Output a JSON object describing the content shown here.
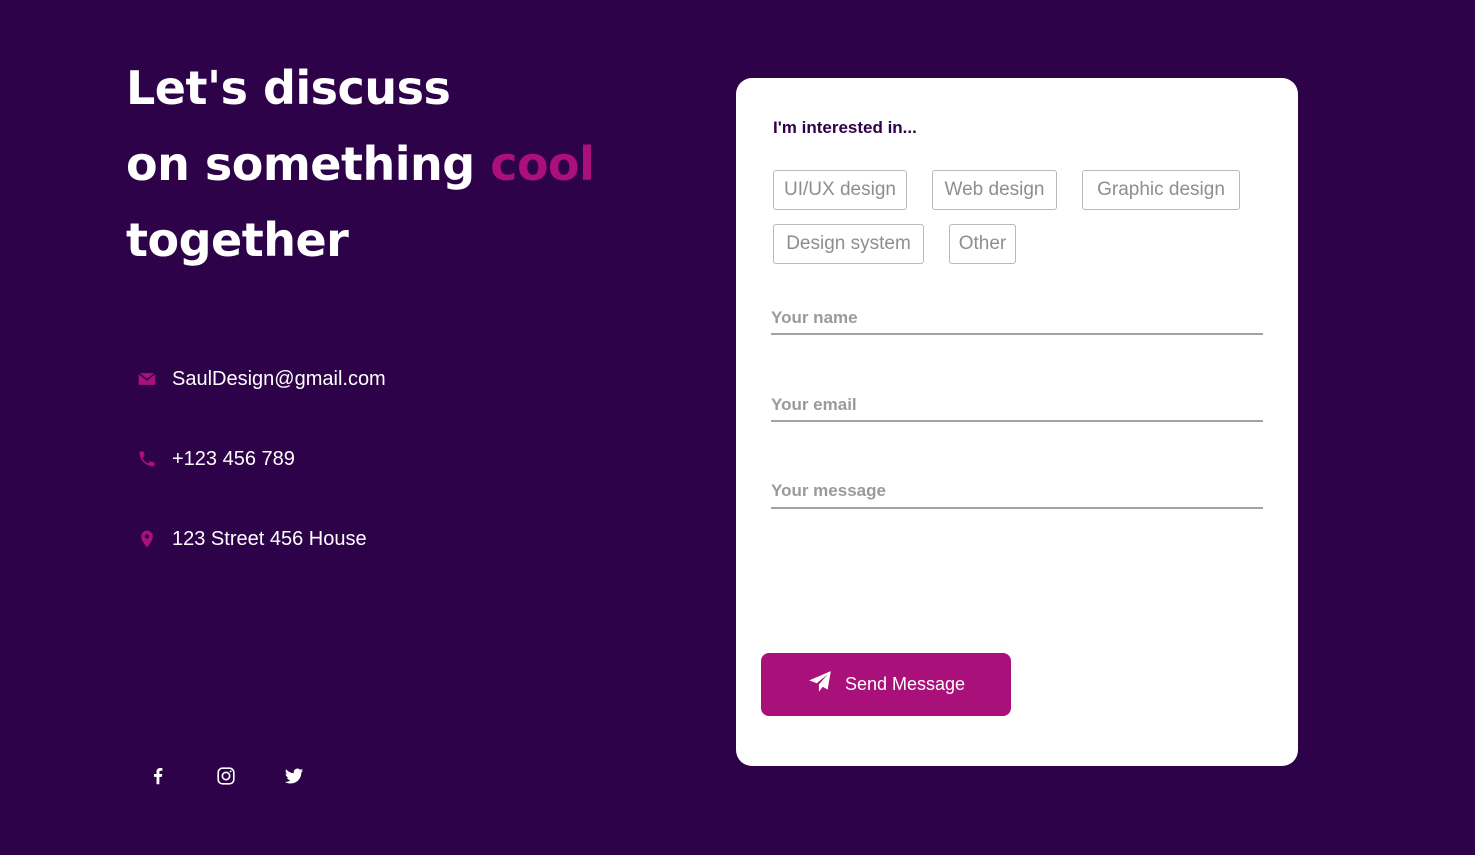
{
  "hero": {
    "line1": "Let's discuss",
    "line2": "on something",
    "line2_accent": "cool",
    "line3": "together"
  },
  "contact": {
    "items": [
      {
        "icon": "envelope-icon",
        "text": "SaulDesign@gmail.com"
      },
      {
        "icon": "phone-icon",
        "text": "+123 456 789"
      },
      {
        "icon": "map-pin-icon",
        "text": "123 Street 456 House"
      }
    ]
  },
  "socials": [
    {
      "icon": "facebook-icon"
    },
    {
      "icon": "instagram-icon"
    },
    {
      "icon": "twitter-icon"
    }
  ],
  "form": {
    "interest_label": "I'm interested in...",
    "interests": [
      "UI/UX design",
      "Web design",
      "Graphic design",
      "Design system",
      "Other"
    ],
    "name_placeholder": "Your name",
    "email_placeholder": "Your email",
    "message_placeholder": "Your message",
    "send_label": "Send Message"
  },
  "colors": {
    "background": "#2e0249",
    "accent": "#a91079",
    "card": "#ffffff"
  }
}
